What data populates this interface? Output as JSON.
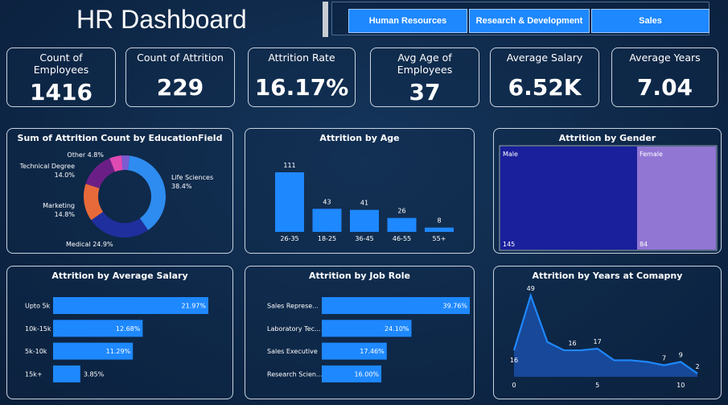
{
  "header": {
    "title": "HR Dashboard"
  },
  "slicer": {
    "items": [
      {
        "label": "Human Resources"
      },
      {
        "label": "Research & Development"
      },
      {
        "label": "Sales"
      }
    ]
  },
  "kpis": [
    {
      "label": "Count of Employees",
      "value": "1416"
    },
    {
      "label": "Count of Attrition",
      "value": "229"
    },
    {
      "label": "Attrition Rate",
      "value": "16.17%"
    },
    {
      "label": "Avg Age of Employees",
      "value": "37"
    },
    {
      "label": "Average Salary",
      "value": "6.52K"
    },
    {
      "label": "Average Years",
      "value": "7.04"
    }
  ],
  "colors": {
    "accent": "#1e88ff",
    "male": "#1a1f9c",
    "female": "#9176d4",
    "background": "#0f2a4a"
  },
  "chart_data": [
    {
      "type": "pie",
      "title": "Sum of Attrition Count by EducationField",
      "slices": [
        {
          "label": "Life Sciences",
          "value": 38.4,
          "display": "38.4%",
          "color": "#2e8cf0"
        },
        {
          "label": "Medical",
          "value": 24.9,
          "display": "24.9%",
          "color": "#1f2f9e"
        },
        {
          "label": "Marketing",
          "value": 14.8,
          "display": "14.8%",
          "color": "#e86a3a"
        },
        {
          "label": "Technical Degree",
          "value": 14.0,
          "display": "14.0%",
          "color": "#6b1f86"
        },
        {
          "label": "Other",
          "value": 4.8,
          "display": "4.8%",
          "color": "#e04ab3"
        },
        {
          "label": "",
          "value": 3.1,
          "display": "",
          "color": "#7b5bd0"
        }
      ]
    },
    {
      "type": "bar",
      "title": "Attrition by Age",
      "categories": [
        "26-35",
        "18-25",
        "36-45",
        "46-55",
        "55+"
      ],
      "values": [
        111,
        43,
        41,
        26,
        8
      ]
    },
    {
      "type": "heatmap",
      "title": "Attrition by Gender",
      "categories": [
        "Male",
        "Female"
      ],
      "values": [
        145,
        84
      ]
    },
    {
      "type": "bar",
      "title": "Attrition by Average Salary",
      "orientation": "horizontal",
      "categories": [
        "Upto 5k",
        "10k-15k",
        "5k-10k",
        "15k+"
      ],
      "values": [
        21.97,
        12.68,
        11.29,
        3.85
      ],
      "labels": [
        "21.97%",
        "12.68%",
        "11.29%",
        "3.85%"
      ]
    },
    {
      "type": "bar",
      "title": "Attrition by Job Role",
      "orientation": "horizontal",
      "categories": [
        "Sales Represe...",
        "Laboratory Tec...",
        "Sales Executive",
        "Research Scien..."
      ],
      "values": [
        39.76,
        24.1,
        17.46,
        16.0
      ],
      "labels": [
        "39.76%",
        "24.10%",
        "17.46%",
        "16.00%"
      ]
    },
    {
      "type": "area",
      "title": "Attrition by Years at Comapny",
      "x": [
        0,
        1,
        2,
        3,
        4,
        5,
        6,
        7,
        8,
        9,
        10,
        11
      ],
      "values": [
        16,
        49,
        21,
        16,
        16,
        17,
        10,
        10,
        9,
        7,
        9,
        2
      ],
      "point_labels": [
        {
          "x": 0,
          "text": "16"
        },
        {
          "x": 1,
          "text": "49"
        },
        {
          "x": 3.5,
          "text": "16"
        },
        {
          "x": 5,
          "text": "17"
        },
        {
          "x": 9,
          "text": "7"
        },
        {
          "x": 10,
          "text": "9"
        },
        {
          "x": 11,
          "text": "2"
        }
      ],
      "xticks": [
        "0",
        "5",
        "10"
      ],
      "xlim": [
        0,
        11
      ],
      "ylim": [
        0,
        52
      ]
    }
  ]
}
